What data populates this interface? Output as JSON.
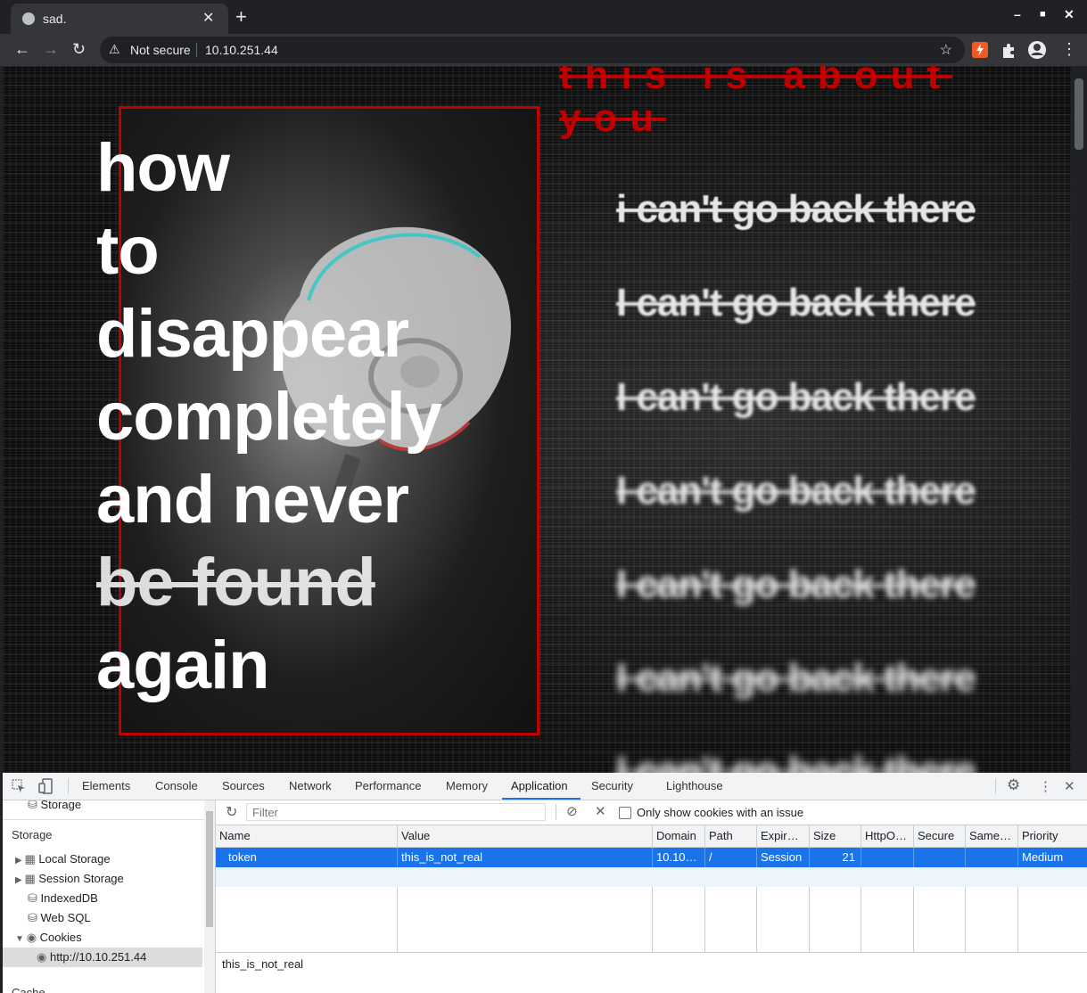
{
  "browser": {
    "tab_title": "sad.",
    "new_tab": "+",
    "window_controls": {
      "minimize": "–",
      "maximize": "■",
      "close": "✕"
    },
    "nav": {
      "back": "←",
      "forward": "→",
      "reload": "↻"
    },
    "security_label": "Not secure",
    "url": "10.10.251.44"
  },
  "page": {
    "heading_lines": [
      "how",
      "to",
      "disappear",
      "completely",
      "and never",
      "be found",
      "again"
    ],
    "red_lines": [
      "this is about",
      "you"
    ],
    "echo_lines": [
      "i can't go back there",
      "I can't go back there",
      "I can't go back there",
      "I can't go back there",
      "I can't go back there",
      "I can't go back there",
      "I can't go back there"
    ]
  },
  "devtools": {
    "tabs": [
      "Elements",
      "Console",
      "Sources",
      "Network",
      "Performance",
      "Memory",
      "Application",
      "Security",
      "Lighthouse"
    ],
    "active_tab": "Application",
    "sidebar": {
      "partial_top": "Storage",
      "section_title": "Storage",
      "items": [
        "Local Storage",
        "Session Storage",
        "IndexedDB",
        "Web SQL",
        "Cookies"
      ],
      "cookie_origin": "http://10.10.251.44",
      "partial_bottom": "Cache"
    },
    "cookies": {
      "filter_placeholder": "Filter",
      "only_issues_label": "Only show cookies with an issue",
      "columns": [
        "Name",
        "Value",
        "Domain",
        "Path",
        "Expir…",
        "Size",
        "HttpO…",
        "Secure",
        "Same…",
        "Priority"
      ],
      "rows": [
        {
          "name": "token",
          "value": "this_is_not_real",
          "domain": "10.10…",
          "path": "/",
          "expires": "Session",
          "size": "21",
          "httponly": "",
          "secure": "",
          "samesite": "",
          "priority": "Medium"
        }
      ],
      "preview_value": "this_is_not_real"
    }
  }
}
